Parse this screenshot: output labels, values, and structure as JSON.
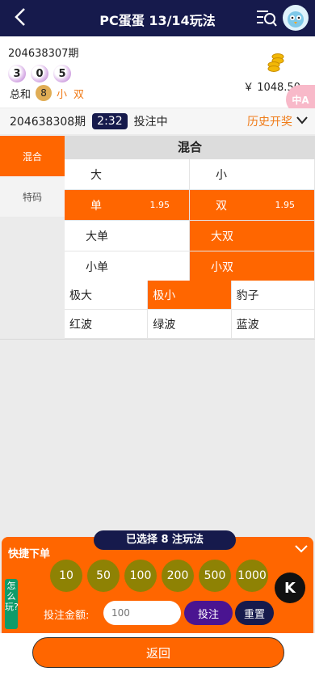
{
  "header": {
    "title": "PC蛋蛋 13/14玩法"
  },
  "last_draw": {
    "period": "204638307期",
    "balls": [
      "3",
      "0",
      "5"
    ],
    "sum_label": "总和",
    "sum": "8",
    "size": "小",
    "parity": "双",
    "balance": "￥ 1048.50"
  },
  "translate_label": "中A",
  "current": {
    "period": "204638308期",
    "countdown": "2:32",
    "status": "投注中",
    "history_label": "历史开奖"
  },
  "side_tabs": [
    "混合",
    "特码"
  ],
  "section_title": "混合",
  "rows2": [
    [
      {
        "label": "大",
        "odds": ""
      },
      {
        "label": "小",
        "odds": ""
      }
    ],
    [
      {
        "label": "单",
        "odds": "1.95"
      },
      {
        "label": "双",
        "odds": "1.95"
      }
    ],
    [
      {
        "label": "大单",
        "odds": ""
      },
      {
        "label": "大双",
        "odds": ""
      }
    ],
    [
      {
        "label": "小单",
        "odds": ""
      },
      {
        "label": "小双",
        "odds": ""
      }
    ]
  ],
  "rows3": [
    [
      "极大",
      "极小",
      "豹子"
    ],
    [
      "红波",
      "绿波",
      "蓝波"
    ]
  ],
  "panel": {
    "quick_label": "快捷下单",
    "selected_text": "已选择 8 注玩法",
    "howto": "怎么玩?",
    "chips": [
      "10",
      "50",
      "100",
      "200",
      "500",
      "1000"
    ],
    "amount_label": "投注金额:",
    "amount_placeholder": "100",
    "bet_label": "投注",
    "reset_label": "重置",
    "k_label": "K"
  },
  "footer": {
    "return_label": "返回"
  },
  "colors": {
    "accent": "#ff6600",
    "navy": "#161a4c",
    "chip": "#8e8204"
  }
}
